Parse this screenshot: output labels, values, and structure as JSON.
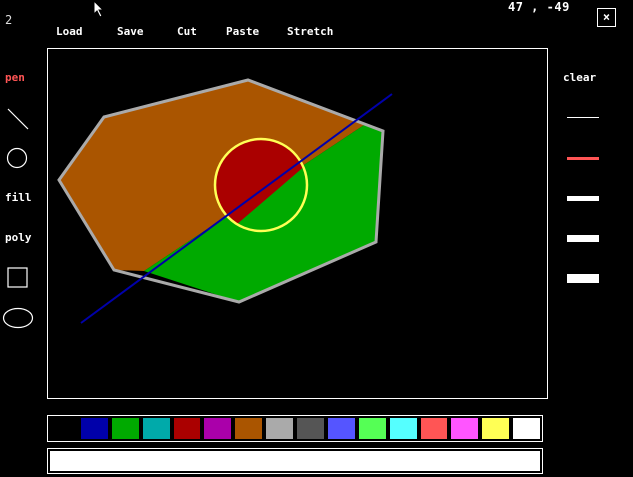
{
  "app": {
    "page_number": "2",
    "coordinates": "47 , -49",
    "close_label": "×"
  },
  "menu": {
    "items": [
      "Load",
      "Save",
      "Cut",
      "Paste",
      "Stretch"
    ]
  },
  "tools": {
    "pen": "pen",
    "fill": "fill",
    "poly": "poly",
    "line_icon": "line-tool-icon",
    "circle_icon": "circle-tool-icon",
    "rect_icon": "rectangle-tool-icon",
    "ellipse_icon": "ellipse-tool-icon",
    "active_color": "#ff5555"
  },
  "right_panel": {
    "clear": "clear",
    "selected_width_index": 1
  },
  "palette": {
    "colors": [
      "#000000",
      "#0000aa",
      "#00aa00",
      "#00aaaa",
      "#aa0000",
      "#aa00aa",
      "#aa5500",
      "#aaaaaa",
      "#555555",
      "#5555ff",
      "#55ff55",
      "#55ffff",
      "#ff5555",
      "#ff55ff",
      "#ffff55",
      "#ffffff"
    ]
  },
  "drawing": {
    "polygon_brown": "#aa5500",
    "polygon_green": "#00aa00",
    "polygon_outline": "#aaaaaa",
    "circle_fill": "#aa0000",
    "circle_outline": "#ffff55",
    "line_color": "#0000aa"
  }
}
